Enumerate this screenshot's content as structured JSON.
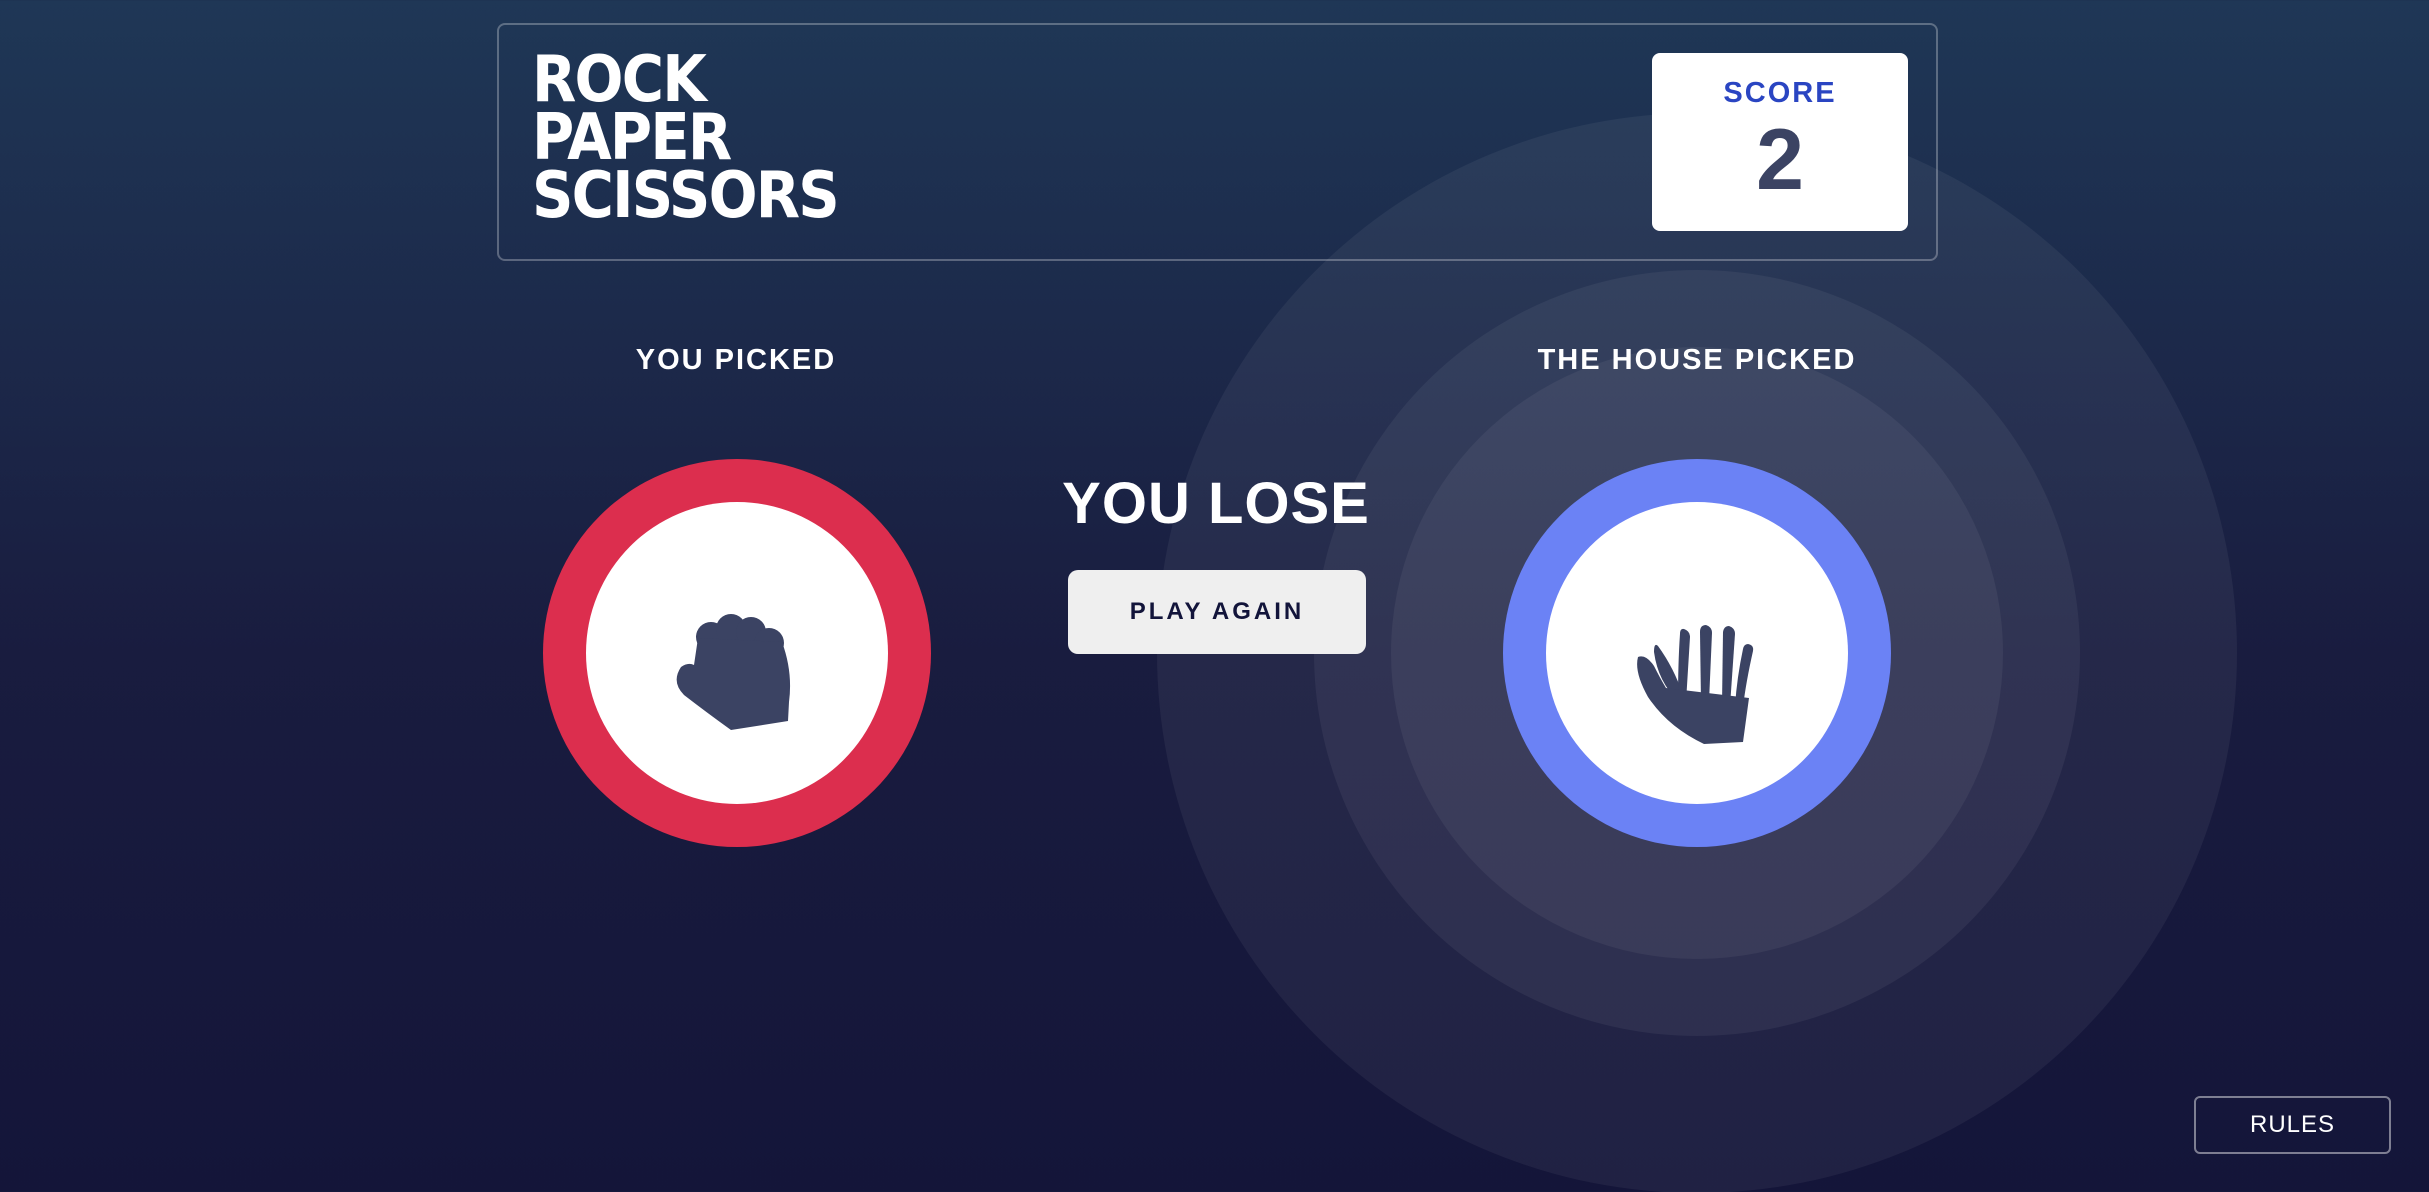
{
  "header": {
    "title_lines": [
      "ROCK",
      "PAPER",
      "SCISSORS"
    ],
    "score_label": "SCORE",
    "score_value": "2"
  },
  "player": {
    "label": "YOU PICKED",
    "choice": "rock",
    "icon": "rock-fist-icon",
    "ring_color": "#dc2e4e"
  },
  "house": {
    "label": "THE HOUSE PICKED",
    "choice": "paper",
    "icon": "paper-hand-icon",
    "ring_color": "#6b82f5",
    "winner": true
  },
  "result": {
    "text": "YOU LOSE",
    "play_again_label": "PLAY AGAIN"
  },
  "footer": {
    "rules_label": "RULES"
  },
  "colors": {
    "background_top": "#1f3756",
    "background_bottom": "#141539",
    "score_label": "#2a45c2",
    "score_value": "#3b4363",
    "icon_fill": "#3b4363"
  }
}
